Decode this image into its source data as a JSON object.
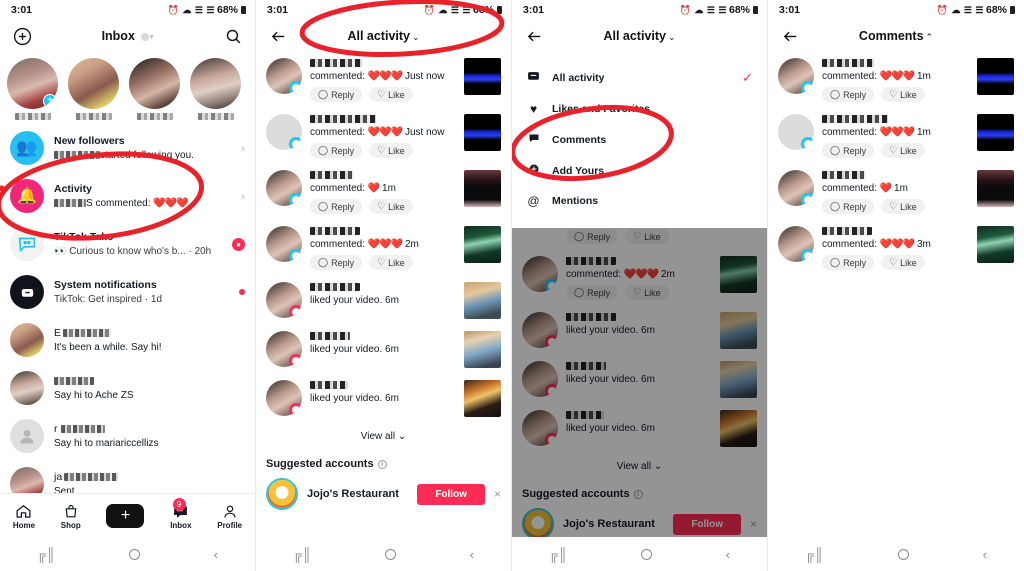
{
  "status_bar": {
    "time": "3:01",
    "battery": "68%",
    "icons": "alarm wifi signal signal"
  },
  "panel1": {
    "header": {
      "title": "Inbox",
      "add_icon": "plus-circle-icon",
      "search_icon": "search-icon"
    },
    "stories_count": 4,
    "items": [
      {
        "name": "New followers",
        "sub_prefix": "",
        "sub": "started following you.",
        "avatar": "people-icon",
        "color": "#27BFF0",
        "chevron": "›",
        "blur_before": true
      },
      {
        "name": "Activity",
        "sub": "S commented:",
        "hearts": "❤️❤️❤️",
        "avatar": "bell-icon",
        "color": "#F0267A",
        "chevron": "›",
        "blur_before": true
      },
      {
        "name": "TikTok Tako",
        "sub": "Curious to know who's b... · 20h",
        "avatar": "tako-icon",
        "badge": "dot-pink"
      },
      {
        "name": "System notifications",
        "sub": "TikTok: Get inspired · 1d",
        "avatar": "mailbox-icon",
        "badge": "dot-small"
      },
      {
        "name": "E",
        "sub": "It's been a while. Say hi!",
        "avatar": "photo",
        "blur_after": true
      },
      {
        "name": "",
        "sub": "Say hi to Ache ZS",
        "avatar": "photo",
        "blur_after": true
      },
      {
        "name": "r",
        "sub": "Say hi to mariariccellizs",
        "avatar": "default-user-icon",
        "blur_after": true
      },
      {
        "name": "ja",
        "sub": "Sent",
        "avatar": "photo",
        "blur_after": true
      }
    ],
    "tabbar": [
      {
        "label": "Home",
        "icon": "home-icon"
      },
      {
        "label": "Shop",
        "icon": "shop-bag-icon"
      },
      {
        "label": "",
        "icon": "create-plus-icon"
      },
      {
        "label": "Inbox",
        "icon": "inbox-icon",
        "badge": "9"
      },
      {
        "label": "Profile",
        "icon": "person-icon"
      }
    ]
  },
  "panel2": {
    "header": {
      "title": "All activity",
      "caret": "⌄",
      "back_icon": "back-arrow-icon"
    },
    "rows": [
      {
        "action": "commented:",
        "hearts": "❤️❤️❤️",
        "time": "Just now",
        "type": "comment",
        "reply": "Reply",
        "like": "Like",
        "thumb": "ph-blue",
        "avatar": "ph-f5"
      },
      {
        "action": "commented:",
        "hearts": "❤️❤️❤️",
        "time": "Just now",
        "type": "comment",
        "reply": "Reply",
        "like": "Like",
        "thumb": "ph-blue",
        "avatar": "ph-grey"
      },
      {
        "action": "commented:",
        "hearts": "❤️",
        "time": "1m",
        "type": "comment",
        "reply": "Reply",
        "like": "Like",
        "thumb": "ph-dark",
        "avatar": "ph-f5"
      },
      {
        "action": "commented:",
        "hearts": "❤️❤️❤️",
        "time": "2m",
        "type": "comment",
        "reply": "Reply",
        "like": "Like",
        "thumb": "ph-bar",
        "avatar": "ph-f5"
      },
      {
        "action": "liked your video.",
        "hearts": "",
        "time": "6m",
        "type": "like",
        "thumb": "ph-kid1",
        "avatar": "ph-f5"
      },
      {
        "action": "liked your video.",
        "hearts": "",
        "time": "6m",
        "type": "like",
        "thumb": "ph-kid2",
        "avatar": "ph-f5"
      },
      {
        "action": "liked your video.",
        "hearts": "",
        "time": "6m",
        "type": "like",
        "thumb": "ph-store",
        "avatar": "ph-f5"
      }
    ],
    "view_all": "View all",
    "view_all_caret": "⌄",
    "suggested_header": "Suggested accounts",
    "suggested": [
      {
        "name": "Jojo's Restaurant",
        "follow": "Follow",
        "close": "×"
      }
    ]
  },
  "panel3": {
    "header": {
      "title": "All activity",
      "caret": "⌄",
      "back_icon": "back-arrow-icon"
    },
    "menu": [
      {
        "label": "All activity",
        "icon": "▣",
        "icon_name": "activity-icon",
        "checked": true
      },
      {
        "label": "Likes and Favorites",
        "icon": "♥",
        "icon_name": "heart-icon",
        "checked": false
      },
      {
        "label": "Comments",
        "icon": "●",
        "icon_name": "comment-bubble-icon",
        "checked": false
      },
      {
        "label": "Add Yours",
        "icon": "●",
        "icon_name": "add-yours-icon",
        "checked": false
      },
      {
        "label": "Mentions",
        "icon": "@",
        "icon_name": "mention-icon",
        "checked": false
      }
    ],
    "check_mark": "✓",
    "rows": [
      {
        "action": "commented:",
        "hearts": "❤️❤️❤️",
        "time": "2m",
        "type": "comment",
        "reply": "Reply",
        "like": "Like",
        "thumb": "ph-bar",
        "avatar": "ph-f5"
      },
      {
        "action": "liked your video.",
        "hearts": "",
        "time": "6m",
        "type": "like",
        "thumb": "ph-kid1",
        "avatar": "ph-f5"
      },
      {
        "action": "liked your video.",
        "hearts": "",
        "time": "6m",
        "type": "like",
        "thumb": "ph-kid2",
        "avatar": "ph-f5"
      },
      {
        "action": "liked your video.",
        "hearts": "",
        "time": "6m",
        "type": "like",
        "thumb": "ph-store",
        "avatar": "ph-f5"
      }
    ],
    "view_all": "View all",
    "view_all_caret": "⌄",
    "suggested_header": "Suggested accounts",
    "suggested": [
      {
        "name": "Jojo's Restaurant",
        "follow": "Follow",
        "close": "×"
      }
    ]
  },
  "panel4": {
    "header": {
      "title": "Comments",
      "caret": "⌃",
      "back_icon": "back-arrow-icon"
    },
    "rows": [
      {
        "action": "commented:",
        "hearts": "❤️❤️❤️",
        "time": "1m",
        "type": "comment",
        "reply": "Reply",
        "like": "Like",
        "thumb": "ph-blue",
        "avatar": "ph-f5"
      },
      {
        "action": "commented:",
        "hearts": "❤️❤️❤️",
        "time": "1m",
        "type": "comment",
        "reply": "Reply",
        "like": "Like",
        "thumb": "ph-blue",
        "avatar": "ph-grey"
      },
      {
        "action": "commented:",
        "hearts": "❤️",
        "time": "1m",
        "type": "comment",
        "reply": "Reply",
        "like": "Like",
        "thumb": "ph-dark",
        "avatar": "ph-f5"
      },
      {
        "action": "commented:",
        "hearts": "❤️❤️❤️",
        "time": "3m",
        "type": "comment",
        "reply": "Reply",
        "like": "Like",
        "thumb": "ph-bar",
        "avatar": "ph-f5"
      }
    ]
  },
  "android_nav": {
    "recents": "‖‖",
    "home": "home-circle",
    "back": "‹"
  },
  "annotations": {
    "color": "#E8222A",
    "shapes": [
      "ellipse-around-activity-row",
      "ellipse-around-all-activity-title",
      "ellipse-around-comments-menu-item"
    ]
  }
}
